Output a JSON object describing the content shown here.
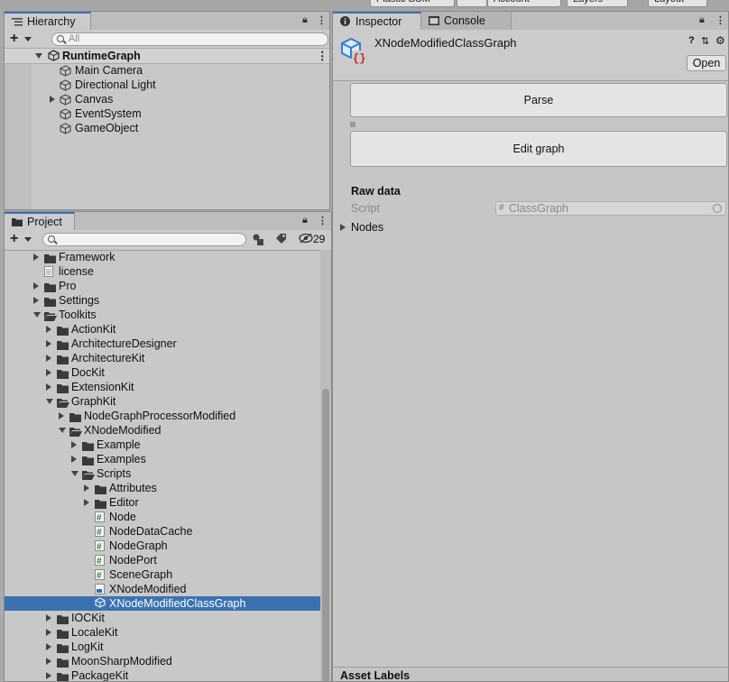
{
  "toolbar": {
    "plastic_scm": "Plastic SCM",
    "account": "Account",
    "layers": "Layers",
    "layout": "Layout"
  },
  "hierarchy": {
    "tab_label": "Hierarchy",
    "search_placeholder": "All",
    "scene_name": "RuntimeGraph",
    "items": [
      {
        "label": "Main Camera",
        "expandable": false
      },
      {
        "label": "Directional Light",
        "expandable": false
      },
      {
        "label": "Canvas",
        "expandable": true
      },
      {
        "label": "EventSystem",
        "expandable": false
      },
      {
        "label": "GameObject",
        "expandable": false
      }
    ]
  },
  "project": {
    "tab_label": "Project",
    "hidden_count": "29",
    "tree": [
      {
        "label": "Framework",
        "icon": "folder",
        "depth": 0,
        "state": "collapsed"
      },
      {
        "label": "license",
        "icon": "document",
        "depth": 0,
        "state": "leaf"
      },
      {
        "label": "Pro",
        "icon": "folder",
        "depth": 0,
        "state": "collapsed"
      },
      {
        "label": "Settings",
        "icon": "folder",
        "depth": 0,
        "state": "collapsed"
      },
      {
        "label": "Toolkits",
        "icon": "folder-open",
        "depth": 0,
        "state": "expanded"
      },
      {
        "label": "ActionKit",
        "icon": "folder",
        "depth": 1,
        "state": "collapsed"
      },
      {
        "label": "ArchitectureDesigner",
        "icon": "folder",
        "depth": 1,
        "state": "collapsed"
      },
      {
        "label": "ArchitectureKit",
        "icon": "folder",
        "depth": 1,
        "state": "collapsed"
      },
      {
        "label": "DocKit",
        "icon": "folder",
        "depth": 1,
        "state": "collapsed"
      },
      {
        "label": "ExtensionKit",
        "icon": "folder",
        "depth": 1,
        "state": "collapsed"
      },
      {
        "label": "GraphKit",
        "icon": "folder-open",
        "depth": 1,
        "state": "expanded"
      },
      {
        "label": "NodeGraphProcessorModified",
        "icon": "folder",
        "depth": 2,
        "state": "collapsed"
      },
      {
        "label": "XNodeModified",
        "icon": "folder-open",
        "depth": 2,
        "state": "expanded"
      },
      {
        "label": "Example",
        "icon": "folder",
        "depth": 3,
        "state": "collapsed"
      },
      {
        "label": "Examples",
        "icon": "folder",
        "depth": 3,
        "state": "collapsed"
      },
      {
        "label": "Scripts",
        "icon": "folder-open",
        "depth": 3,
        "state": "expanded"
      },
      {
        "label": "Attributes",
        "icon": "folder",
        "depth": 4,
        "state": "collapsed"
      },
      {
        "label": "Editor",
        "icon": "folder",
        "depth": 4,
        "state": "collapsed"
      },
      {
        "label": "Node",
        "icon": "script",
        "depth": 4,
        "state": "leaf"
      },
      {
        "label": "NodeDataCache",
        "icon": "script",
        "depth": 4,
        "state": "leaf"
      },
      {
        "label": "NodeGraph",
        "icon": "script",
        "depth": 4,
        "state": "leaf"
      },
      {
        "label": "NodePort",
        "icon": "script",
        "depth": 4,
        "state": "leaf"
      },
      {
        "label": "SceneGraph",
        "icon": "script",
        "depth": 4,
        "state": "leaf"
      },
      {
        "label": "XNodeModified",
        "icon": "asmdef",
        "depth": 4,
        "state": "leaf"
      },
      {
        "label": "XNodeModifiedClassGraph",
        "icon": "scriptable-object",
        "depth": 4,
        "state": "leaf",
        "selected": true
      },
      {
        "label": "IOCKit",
        "icon": "folder",
        "depth": 1,
        "state": "collapsed"
      },
      {
        "label": "LocaleKit",
        "icon": "folder",
        "depth": 1,
        "state": "collapsed"
      },
      {
        "label": "LogKit",
        "icon": "folder",
        "depth": 1,
        "state": "collapsed"
      },
      {
        "label": "MoonSharpModified",
        "icon": "folder",
        "depth": 1,
        "state": "collapsed"
      },
      {
        "label": "PackageKit",
        "icon": "folder",
        "depth": 1,
        "state": "collapsed"
      }
    ]
  },
  "inspector": {
    "tab_label": "Inspector",
    "console_tab_label": "Console",
    "asset_title": "XNodeModifiedClassGraph",
    "open_button": "Open",
    "parse_button": "Parse",
    "edit_graph_button": "Edit graph",
    "raw_data_header": "Raw data",
    "script_label": "Script",
    "script_value": "ClassGraph",
    "nodes_label": "Nodes",
    "asset_labels": "Asset Labels"
  },
  "colors": {
    "selection": "#3a72b0",
    "panel_bg": "#c8c8c8",
    "script_icon": "#2e7d32",
    "asset_icon_blue": "#2f7fd0",
    "asset_icon_red": "#d0202a"
  }
}
